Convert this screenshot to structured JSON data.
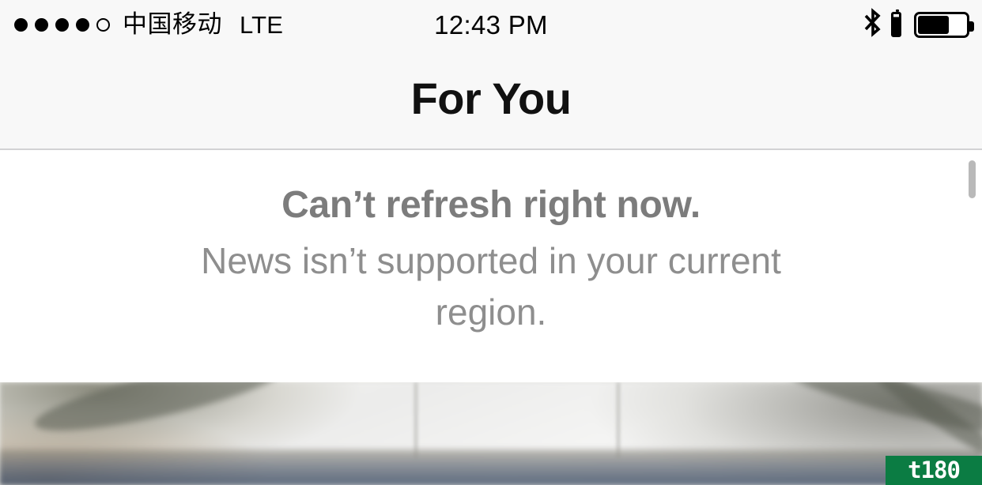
{
  "status_bar": {
    "signal": {
      "icon": "signal-dots",
      "total_bars": 5,
      "filled_bars": 4
    },
    "carrier": "中国移动",
    "network_type": "LTE",
    "time": "12:43 PM",
    "bluetooth_icon": "bluetooth-icon",
    "accessory_battery": {
      "icon": "accessory-battery-icon",
      "level_percent": 86
    },
    "battery": {
      "icon": "battery-icon",
      "level_percent": 62
    }
  },
  "nav_bar": {
    "title": "For You"
  },
  "content": {
    "empty_state": {
      "title": "Can’t refresh right now.",
      "message": "News isn’t supported in your current region."
    },
    "scroll_indicator": "scroll-indicator"
  },
  "photo": {
    "alt": "blurred photo of a white ceiling and interior"
  },
  "watermark": {
    "text": "t180",
    "background_color": "#0b7c43",
    "text_color": "#ffffff"
  },
  "colors": {
    "status_bar_bg": "#f8f8f8",
    "nav_bar_bg": "#f8f8f8",
    "nav_divider": "#d2d2d4",
    "content_bg": "#ffffff",
    "title_text": "#7c7c7c",
    "message_text": "#8e8e8e",
    "nav_title_text": "#111111"
  }
}
